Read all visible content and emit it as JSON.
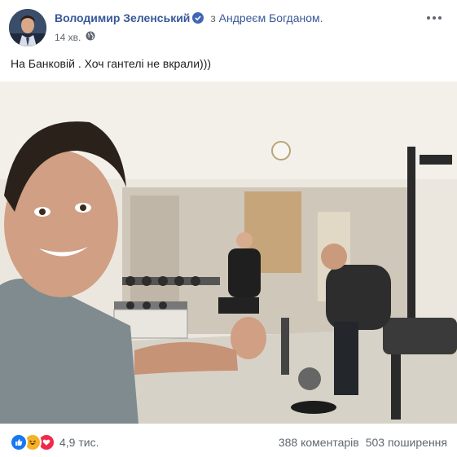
{
  "post": {
    "author": "Володимир Зеленський",
    "with_prefix": "з",
    "tagged_person": "Андреєм Богданом.",
    "time": "14 хв.",
    "text": "На Банковій . Хоч гантелі не вкрали)))"
  },
  "footer": {
    "reaction_count": "4,9 тис.",
    "comments": "388 коментарів",
    "shares": "503 поширення"
  },
  "icons": [
    "verified-badge-icon",
    "globe-icon",
    "more-options-icon",
    "like-reaction-icon",
    "haha-reaction-icon",
    "love-reaction-icon"
  ],
  "colors": {
    "link": "#385898",
    "meta": "#606770",
    "like": "#1877f2",
    "haha": "#f7b125",
    "love": "#f0284a"
  }
}
